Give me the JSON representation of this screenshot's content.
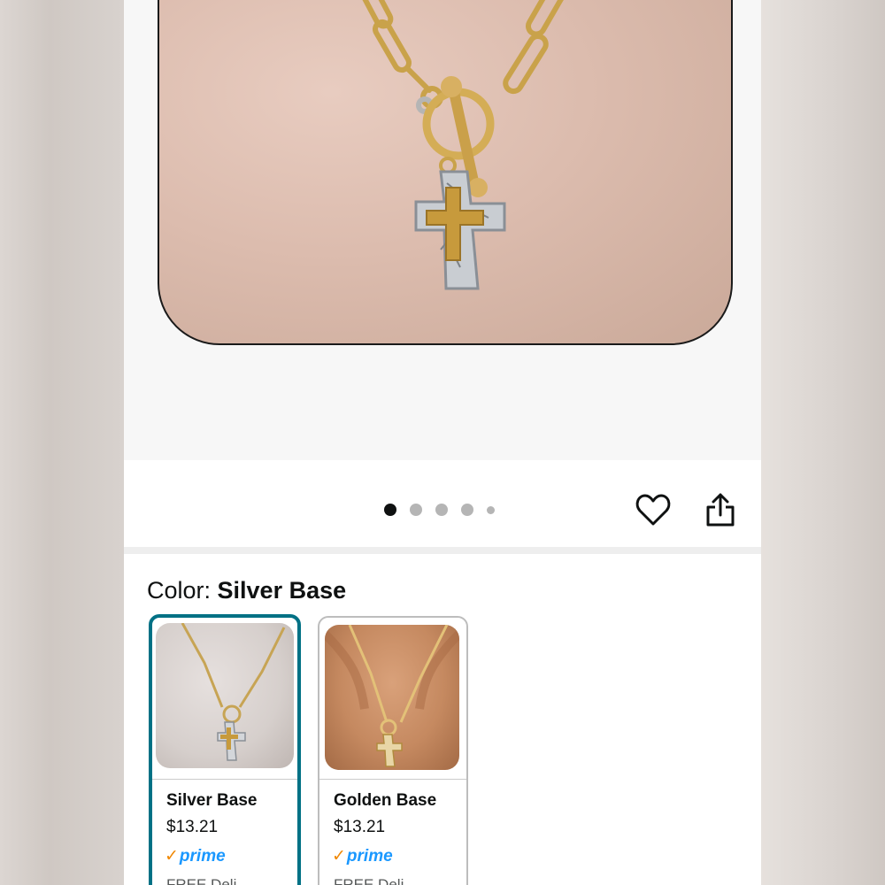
{
  "carousel": {
    "dots": [
      "active",
      "inactive",
      "inactive",
      "inactive",
      "inactive-small"
    ]
  },
  "actions": {
    "favorite_icon": "heart-outline-icon",
    "share_icon": "share-icon"
  },
  "color": {
    "label": "Color: ",
    "selected_value": "Silver Base"
  },
  "variants": [
    {
      "name": "Silver Base",
      "price": "$13.21",
      "prime_check": "✓",
      "prime_label": "prime",
      "delivery": "FREE Deli"
    },
    {
      "name": "Golden Base",
      "price": "$13.21",
      "prime_check": "✓",
      "prime_label": "prime",
      "delivery": "FREE Deli"
    }
  ],
  "colors": {
    "accent_selected": "#007185",
    "prime_blue": "#1a98ff",
    "prime_check_orange": "#f08804",
    "active_dot": "#0f1111",
    "inactive_dot": "#b5b5b5"
  }
}
